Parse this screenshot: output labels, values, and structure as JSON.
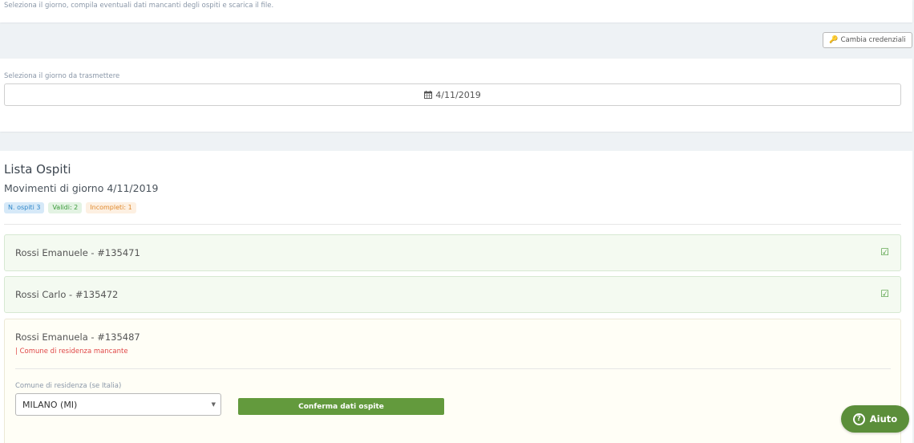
{
  "header": {
    "description": "Seleziona il giorno, compila eventuali dati mancanti degli ospiti e scarica il file.",
    "credentials_button": "Cambia credenziali"
  },
  "day_selector": {
    "label": "Seleziona il giorno da trasmettere",
    "value": "4/11/2019"
  },
  "guest_list": {
    "title": "Lista Ospiti",
    "subtitle": "Movimenti di giorno 4/11/2019",
    "badges": {
      "total": "N. ospiti 3",
      "valid": "Validi: 2",
      "incomplete": "Incompleti: 1"
    },
    "guests": [
      {
        "name": "Rossi Emanuele - #135471",
        "status": "valid"
      },
      {
        "name": "Rossi Carlo - #135472",
        "status": "valid"
      },
      {
        "name": "Rossi Emanuela - #135487",
        "status": "incomplete",
        "error": "| Comune di residenza mancante"
      }
    ],
    "form": {
      "residence_label": "Comune di residenza (se Italia)",
      "residence_value": "MILANO (MI)",
      "confirm_button": "Conferma dati ospite"
    }
  },
  "help": {
    "label": "Aiuto"
  },
  "colors": {
    "accent_green": "#639a3d",
    "valid_bg": "#f4faf1",
    "error_red": "#e04848"
  },
  "icons": {
    "credentials": "key-icon",
    "calendar": "calendar-icon",
    "valid": "checkbox-checked-icon",
    "dropdown": "chevron-down-icon",
    "help": "question-circle-icon"
  }
}
